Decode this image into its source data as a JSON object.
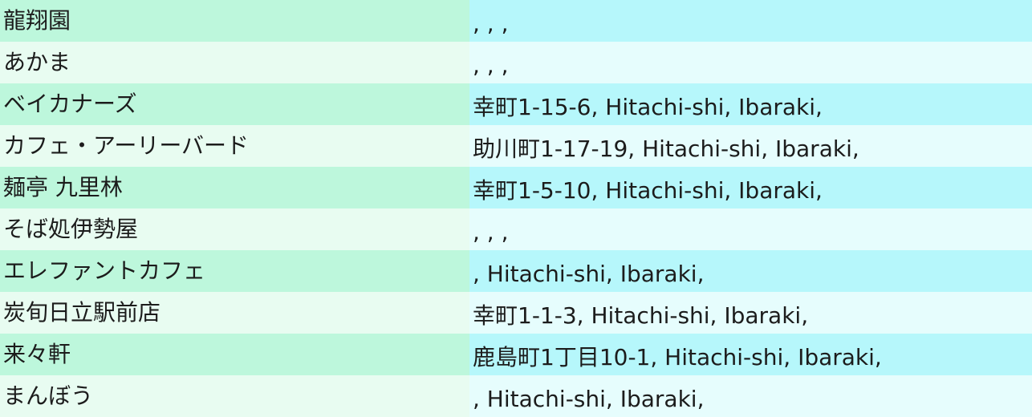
{
  "rows": [
    {
      "name": "龍翔園",
      "address": ", , ,"
    },
    {
      "name": "あかま",
      "address": ", , ,"
    },
    {
      "name": "ベイカナーズ",
      "address": "幸町1-15-6, Hitachi-shi, Ibaraki,"
    },
    {
      "name": "カフェ・アーリーバード",
      "address": "助川町1-17-19, Hitachi-shi, Ibaraki,"
    },
    {
      "name": "麺亭 九里林",
      "address": "幸町1-5-10, Hitachi-shi, Ibaraki,"
    },
    {
      "name": "そば処伊勢屋",
      "address": ", , ,"
    },
    {
      "name": "エレファントカフェ",
      "address": ", Hitachi-shi, Ibaraki,"
    },
    {
      "name": "炭旬日立駅前店",
      "address": "幸町1-1-3, Hitachi-shi, Ibaraki,"
    },
    {
      "name": "来々軒",
      "address": "鹿島町1丁目10-1, Hitachi-shi, Ibaraki,"
    },
    {
      "name": "まんぼう",
      "address": ", Hitachi-shi, Ibaraki,"
    }
  ],
  "colors": {
    "name_odd": "#bdf7dc",
    "name_even": "#e8fcf1",
    "address_odd": "#b6f7fb",
    "address_even": "#e6fdfd"
  }
}
